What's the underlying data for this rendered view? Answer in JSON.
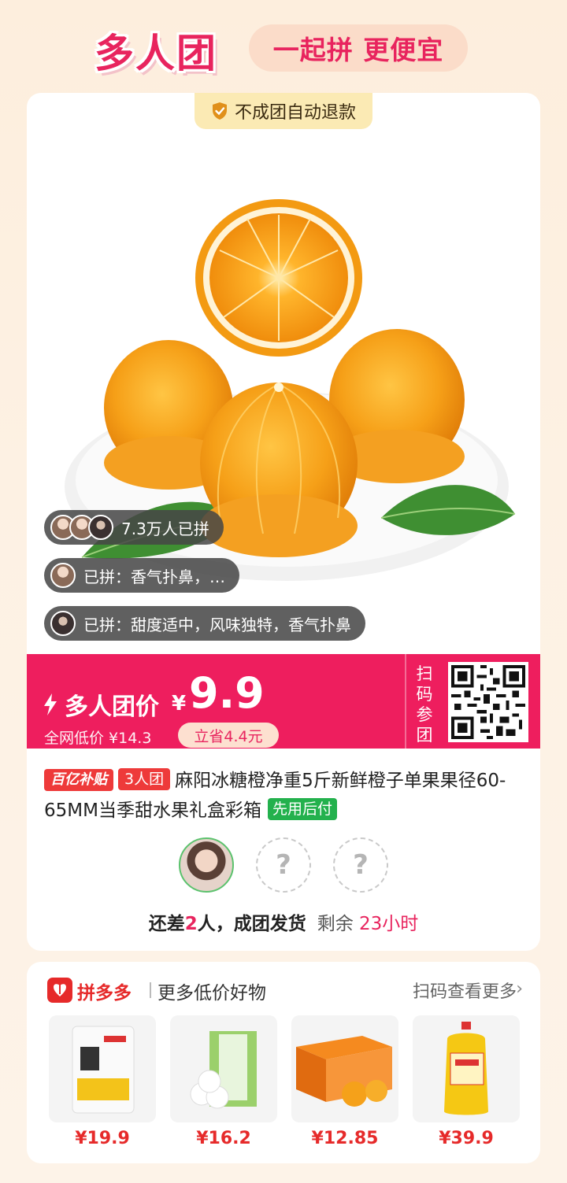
{
  "header": {
    "brand": "多人团",
    "slogan": "一起拼 更便宜"
  },
  "card": {
    "refund_badge": "不成团自动退款",
    "social": {
      "joined_count": "7.3万人已拼",
      "review1": "已拼：香气扑鼻，…",
      "review2": "已拼：甜度适中，风味独特，香气扑鼻"
    },
    "price": {
      "label": "多人团价",
      "currency": "¥",
      "amount": "9.9",
      "market": "全网低价 ¥14.3",
      "save": "立省4.4元",
      "scan": "扫码参团"
    },
    "tags": {
      "subsidy": "百亿补贴",
      "group": "3人团",
      "pay_later": "先用后付"
    },
    "title": "麻阳冰糖橙净重5斤新鲜橙子单果果径60-65MM当季甜水果礼盒彩箱",
    "members": {
      "empty_mark": "?"
    },
    "status": {
      "prefix": "还差",
      "missing": "2",
      "suffix": "人，成团发货",
      "remaining_label": "剩余",
      "remaining_time": "23小时"
    }
  },
  "recommend": {
    "brand": "拼多多",
    "subtitle": "更多低价好物",
    "more": "扫码查看更多",
    "items": [
      {
        "name": "flour-bag",
        "price": "¥19.9"
      },
      {
        "name": "tissue-pack",
        "price": "¥16.2"
      },
      {
        "name": "orange-box",
        "price": "¥12.85"
      },
      {
        "name": "cooking-oil",
        "price": "¥39.9"
      }
    ]
  },
  "colors": {
    "accent": "#e8245e",
    "price_bar": "#ee1e5e",
    "green": "#23b14d"
  }
}
